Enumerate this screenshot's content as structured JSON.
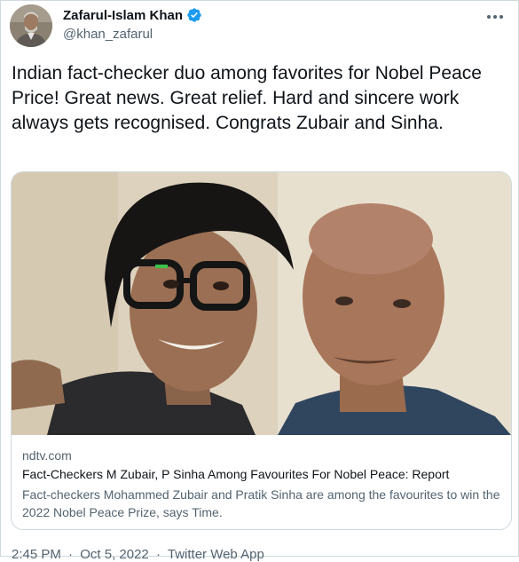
{
  "author": {
    "display_name": "Zafarul-Islam Khan",
    "handle": "@khan_zafarul"
  },
  "tweet": {
    "text": "Indian fact-checker duo among favorites for Nobel Peace Price! Great news. Great relief. Hard and sincere work always gets recognised. Congrats Zubair and Sinha."
  },
  "card": {
    "domain": "ndtv.com",
    "title": "Fact-Checkers M Zubair, P Sinha Among Favourites For Nobel Peace: Report",
    "description": "Fact-checkers Mohammed Zubair and Pratik Sinha are among the favourites to win the 2022 Nobel Peace Prize, says Time."
  },
  "meta": {
    "time": "2:45 PM",
    "sep1": "·",
    "date": "Oct 5, 2022",
    "sep2": "·",
    "source": "Twitter Web App"
  },
  "colors": {
    "verified_badge": "#1d9bf0",
    "primary_text": "#0f1419",
    "secondary_text": "#536471",
    "border": "#cfd9de"
  },
  "icons": {
    "verified": "verified-badge-icon",
    "more": "more-icon"
  }
}
